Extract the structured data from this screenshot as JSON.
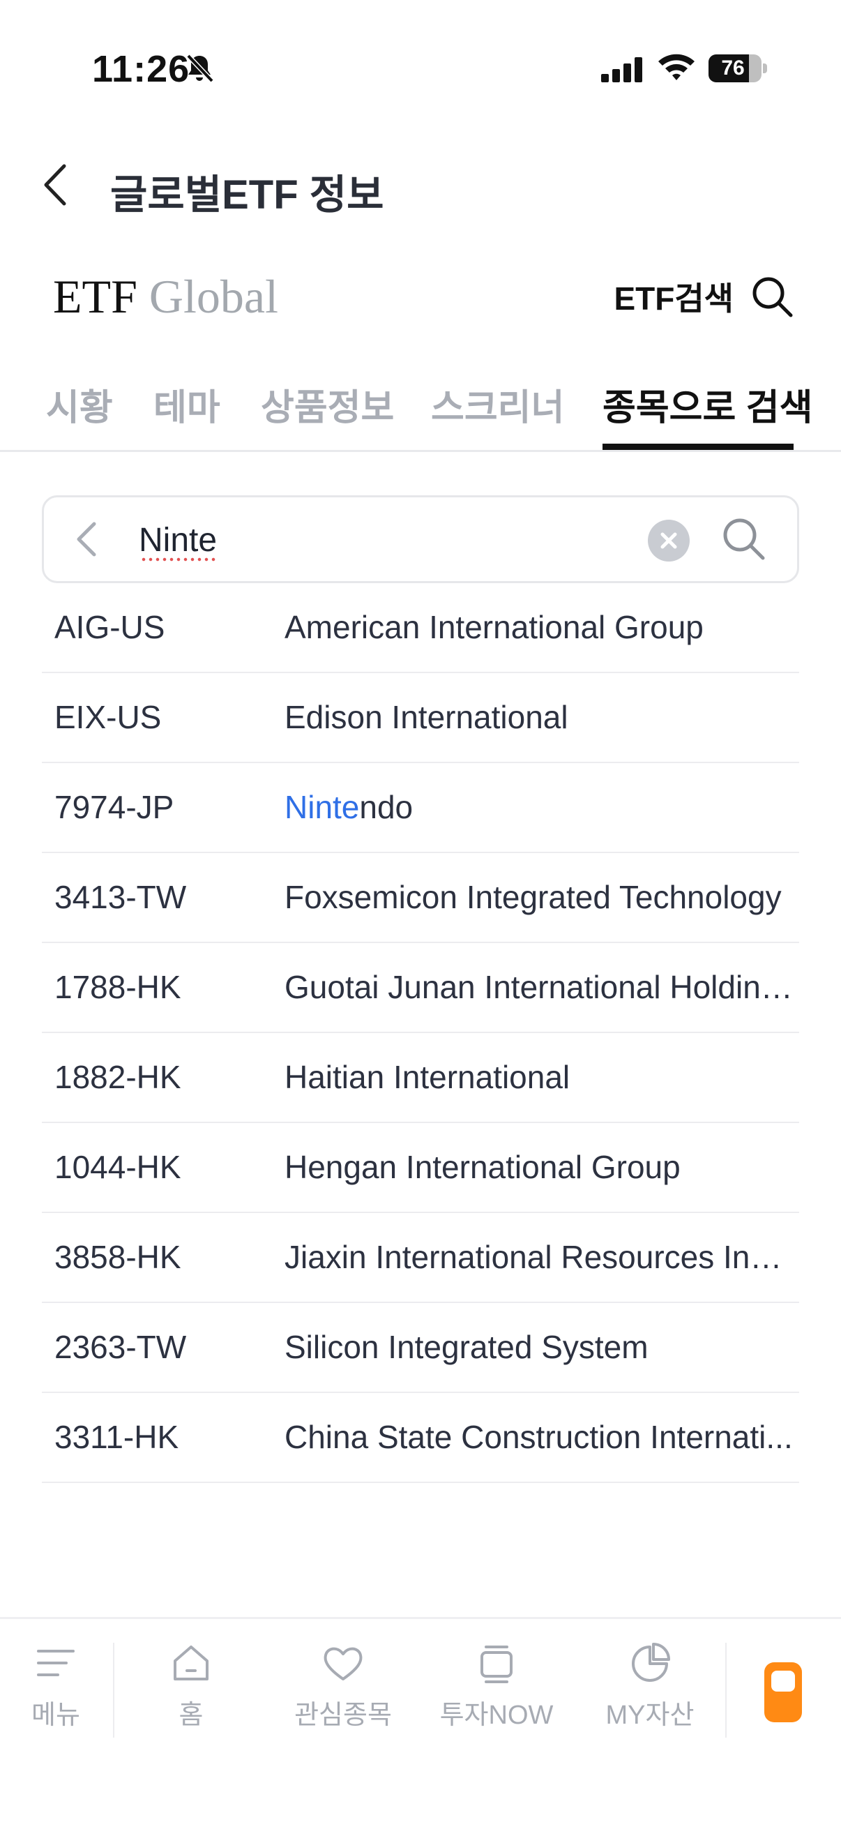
{
  "status_bar": {
    "time": "11:26",
    "battery": "76",
    "battery_level": 0.76
  },
  "header": {
    "title": "글로벌ETF 정보"
  },
  "brand": {
    "etf": "ETF",
    "global": "Global"
  },
  "etf_search": {
    "label": "ETF검색"
  },
  "tabs": [
    {
      "label": "시황",
      "active": false
    },
    {
      "label": "테마",
      "active": false
    },
    {
      "label": "상품정보",
      "active": false
    },
    {
      "label": "스크리너",
      "active": false
    },
    {
      "label": "종목으로 검색",
      "active": true
    }
  ],
  "search": {
    "value": "Ninte",
    "placeholder": ""
  },
  "results": [
    {
      "ticker": "AIG-US",
      "name": "American International Group",
      "match": "",
      "rest": ""
    },
    {
      "ticker": "EIX-US",
      "name": "Edison International",
      "match": "",
      "rest": ""
    },
    {
      "ticker": "7974-JP",
      "name": "",
      "match": "Ninte",
      "rest": "ndo"
    },
    {
      "ticker": "3413-TW",
      "name": "Foxsemicon Integrated Technology",
      "match": "",
      "rest": ""
    },
    {
      "ticker": "1788-HK",
      "name": "Guotai Junan International Holdings",
      "match": "",
      "rest": ""
    },
    {
      "ticker": "1882-HK",
      "name": "Haitian International",
      "match": "",
      "rest": ""
    },
    {
      "ticker": "1044-HK",
      "name": "Hengan International Group",
      "match": "",
      "rest": ""
    },
    {
      "ticker": "3858-HK",
      "name": "Jiaxin International Resources Inve...",
      "match": "",
      "rest": ""
    },
    {
      "ticker": "2363-TW",
      "name": "Silicon Integrated System",
      "match": "",
      "rest": ""
    },
    {
      "ticker": "3311-HK",
      "name": "China State Construction Internati...",
      "match": "",
      "rest": ""
    }
  ],
  "bottom_nav": [
    {
      "label": "메뉴",
      "icon": "menu-icon"
    },
    {
      "label": "홈",
      "icon": "home-icon"
    },
    {
      "label": "관심종목",
      "icon": "heart-icon"
    },
    {
      "label": "투자NOW",
      "icon": "invest-now-icon"
    },
    {
      "label": "MY자산",
      "icon": "pie-chart-icon"
    }
  ],
  "colors": {
    "accent_highlight": "#2f6fe6",
    "orange": "#ff8a14",
    "inactive": "#a9adb5"
  }
}
